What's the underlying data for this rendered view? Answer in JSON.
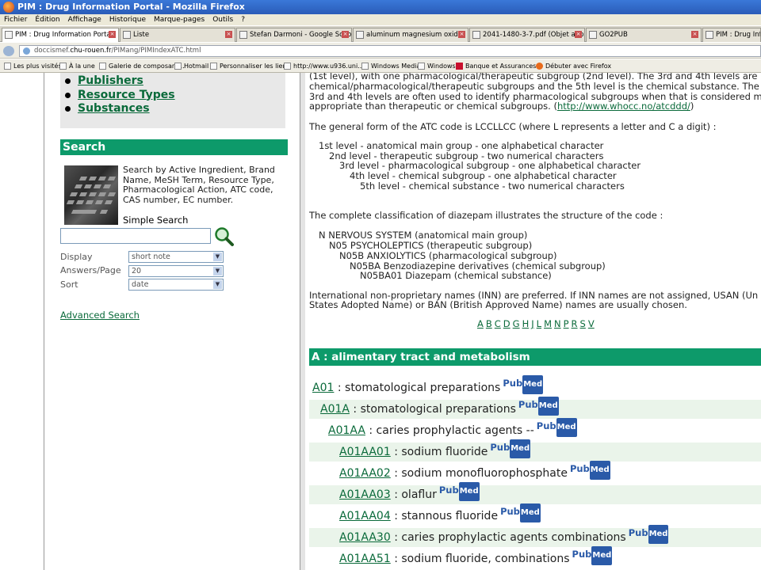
{
  "window": {
    "title": "PIM : Drug Information Portal - Mozilla Firefox"
  },
  "menu": [
    "Fichier",
    "Édition",
    "Affichage",
    "Historique",
    "Marque-pages",
    "Outils",
    "?"
  ],
  "tabs": [
    "PIM : Drug Information Portal",
    "Liste",
    "Stefan Darmoni - Google Scholar ...",
    "aluminum magnesium oxide",
    "2041-1480-3-7.pdf (Objet applic...",
    "GO2PUB",
    "PIM : Drug Inform"
  ],
  "url": {
    "prefix": "doccismef.",
    "domain": "chu-rouen.fr",
    "path": "/PIMang/PIMIndexATC.html"
  },
  "bookmarks": [
    "Les plus visités",
    "À la une",
    "Galerie de composant...",
    "Hotmail",
    "Personnaliser les liens",
    "http://www.u936.uni...",
    "Windows Media",
    "Windows",
    "Banque et Assurances...",
    "Débuter avec Firefox"
  ],
  "sidebar": {
    "nav_items": [
      "Publishers",
      "Resource Types",
      "Substances"
    ],
    "search_header": "Search",
    "search_description": "Search by Active Ingredient, Brand Name, MeSH Term, Resource Type, Pharmacological Action, ATC code, CAS number, EC number.",
    "simple_search_label": "Simple Search",
    "display_label": "Display",
    "display_value": "short note",
    "answers_label": "Answers/Page",
    "answers_value": "20",
    "sort_label": "Sort",
    "sort_value": "date",
    "advanced_search": "Advanced Search"
  },
  "content": {
    "intro_lines": [
      "(1st level), with one pharmacological/therapeutic subgroup (2nd level). The 3rd and 4th levels are",
      "chemical/pharmacological/therapeutic subgroups and the 5th level is the chemical substance. The",
      "3rd and 4th levels are often used to identify pharmacological subgroups when that is considered m",
      "appropriate than therapeutic or chemical subgroups. ("
    ],
    "who_link": "http://www.whocc.no/atcddd/",
    "intro_end": ")",
    "general_form": "The general form of the ATC code is LCCLLCC (where L represents a letter and C a digit) :",
    "levels": [
      "1st level - anatomical main group - one alphabetical character",
      "2nd level - therapeutic subgroup - two numerical characters",
      "3rd level - pharmacological subgroup - one alphabetical character",
      "4th level - chemical subgroup - one alphabetical character",
      "5th level - chemical substance - two numerical characters"
    ],
    "classification_intro": "The complete classification of diazepam illustrates the structure of the code :",
    "diazepam": [
      "N NERVOUS SYSTEM (anatomical main group)",
      "N05 PSYCHOLEPTICS (therapeutic subgroup)",
      "N05B ANXIOLYTICS (pharmacological subgroup)",
      "N05BA Benzodiazepine derivatives (chemical subgroup)",
      "N05BA01 Diazepam (chemical substance)"
    ],
    "inn_line1": "International non-proprietary names (INN) are preferred. If INN names are not assigned, USAN (Un",
    "inn_line2": "States Adopted Name) or BAN (British Approved Name) names are usually chosen.",
    "alphabet": [
      "A",
      "B",
      "C",
      "D",
      "G",
      "H",
      "J",
      "L",
      "M",
      "N",
      "P",
      "R",
      "S",
      "V"
    ],
    "section_header": "A : alimentary tract and metabolism",
    "pubmed_pub": "Pub",
    "pubmed_med": "Med",
    "atc_rows": [
      {
        "code": "A01",
        "label": " : stomatological preparations"
      },
      {
        "code": "A01A",
        "label": " : stomatological preparations"
      },
      {
        "code": "A01AA",
        "label": " : caries prophylactic agents --"
      },
      {
        "code": "A01AA01",
        "label": " : sodium fluoride"
      },
      {
        "code": "A01AA02",
        "label": " : sodium monofluorophosphate"
      },
      {
        "code": "A01AA03",
        "label": " : olaflur"
      },
      {
        "code": "A01AA04",
        "label": " : stannous fluoride"
      },
      {
        "code": "A01AA30",
        "label": " : caries prophylactic agents combinations"
      },
      {
        "code": "A01AA51",
        "label": " : sodium fluoride, combinations"
      }
    ]
  }
}
